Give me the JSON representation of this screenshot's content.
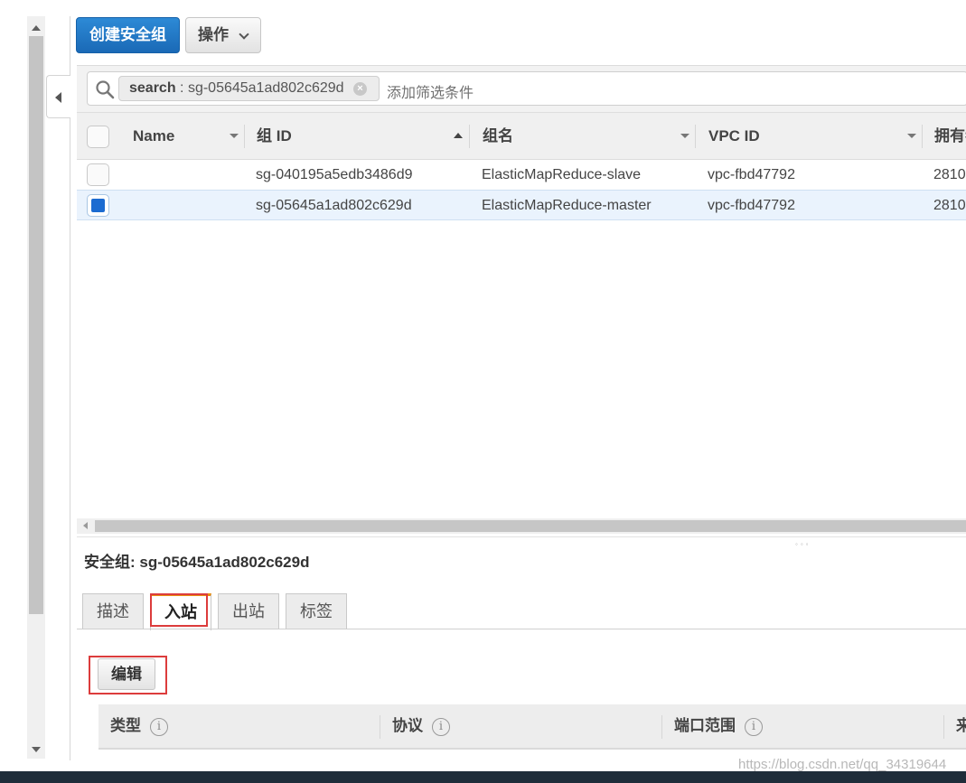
{
  "toolbar": {
    "create_label": "创建安全组",
    "actions_label": "操作"
  },
  "filter": {
    "token_key": "search",
    "token_sep": " : ",
    "token_value": "sg-05645a1ad802c629d",
    "token_remove": "×",
    "placeholder": "添加筛选条件"
  },
  "table": {
    "columns": [
      "Name",
      "组 ID",
      "组名",
      "VPC ID",
      "拥有者"
    ],
    "rows": [
      {
        "name": "",
        "group_id": "sg-040195a5edb3486d9",
        "group_name": "ElasticMapReduce-slave",
        "vpc_id": "vpc-fbd47792",
        "owner": "2810"
      },
      {
        "name": "",
        "group_id": "sg-05645a1ad802c629d",
        "group_name": "ElasticMapReduce-master",
        "vpc_id": "vpc-fbd47792",
        "owner": "2810"
      }
    ],
    "selected_index": 1
  },
  "detail": {
    "title": "安全组: sg-05645a1ad802c629d",
    "tabs": [
      "描述",
      "入站",
      "出站",
      "标签"
    ],
    "active_tab": "入站",
    "edit_label": "编辑",
    "rule_columns": [
      "类型",
      "协议",
      "端口范围",
      "来"
    ],
    "info_glyph": "i"
  },
  "watermark": "https://blog.csdn.net/qq_34319644",
  "colors": {
    "primary": "#1a69b6",
    "selected_row": "#eaf3fd",
    "checkbox_on": "#1b6bd1",
    "tab_accent": "#e98f12",
    "highlight_box": "#dc3c3c"
  }
}
